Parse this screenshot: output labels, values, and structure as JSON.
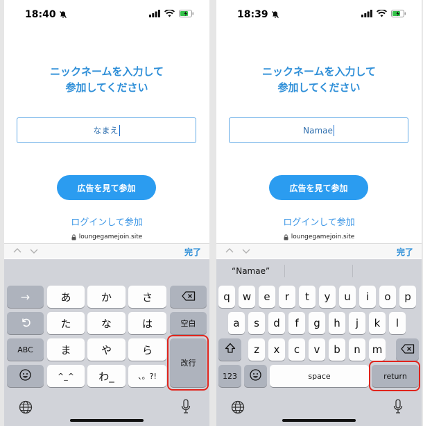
{
  "left": {
    "status": {
      "time": "18:40"
    },
    "title": {
      "line1": "ニックネームを入力して",
      "line2": "参加してください"
    },
    "input_value": "なまえ",
    "ad_button": "広告を見て参加",
    "login_link": "ログインして参加",
    "url": "loungegamejoin.site",
    "done": "完了",
    "keys": {
      "arrow": "→",
      "row1": [
        "あ",
        "か",
        "さ"
      ],
      "row2": [
        "た",
        "な",
        "は"
      ],
      "row3": [
        "ABC",
        "ま",
        "や",
        "ら"
      ],
      "row4": [
        "^_^",
        "わ_",
        "、。?!"
      ],
      "space": "空白",
      "enter": "改行"
    }
  },
  "right": {
    "status": {
      "time": "18:39"
    },
    "title": {
      "line1": "ニックネームを入力して",
      "line2": "参加してください"
    },
    "input_value": "Namae",
    "ad_button": "広告を見て参加",
    "login_link": "ログインして参加",
    "url": "loungegamejoin.site",
    "done": "完了",
    "suggestion": "“Namae”",
    "keys": {
      "row1": [
        "q",
        "w",
        "e",
        "r",
        "t",
        "y",
        "u",
        "i",
        "o",
        "p"
      ],
      "row2": [
        "a",
        "s",
        "d",
        "f",
        "g",
        "h",
        "j",
        "k",
        "l"
      ],
      "row3": [
        "z",
        "x",
        "c",
        "v",
        "b",
        "n",
        "m"
      ],
      "numbers": "123",
      "space": "space",
      "return": "return"
    }
  },
  "colors": {
    "accent": "#2f8fd8",
    "button": "#2b9cf0",
    "highlight": "#e0241c",
    "keyboard_bg": "#d1d3d9"
  }
}
